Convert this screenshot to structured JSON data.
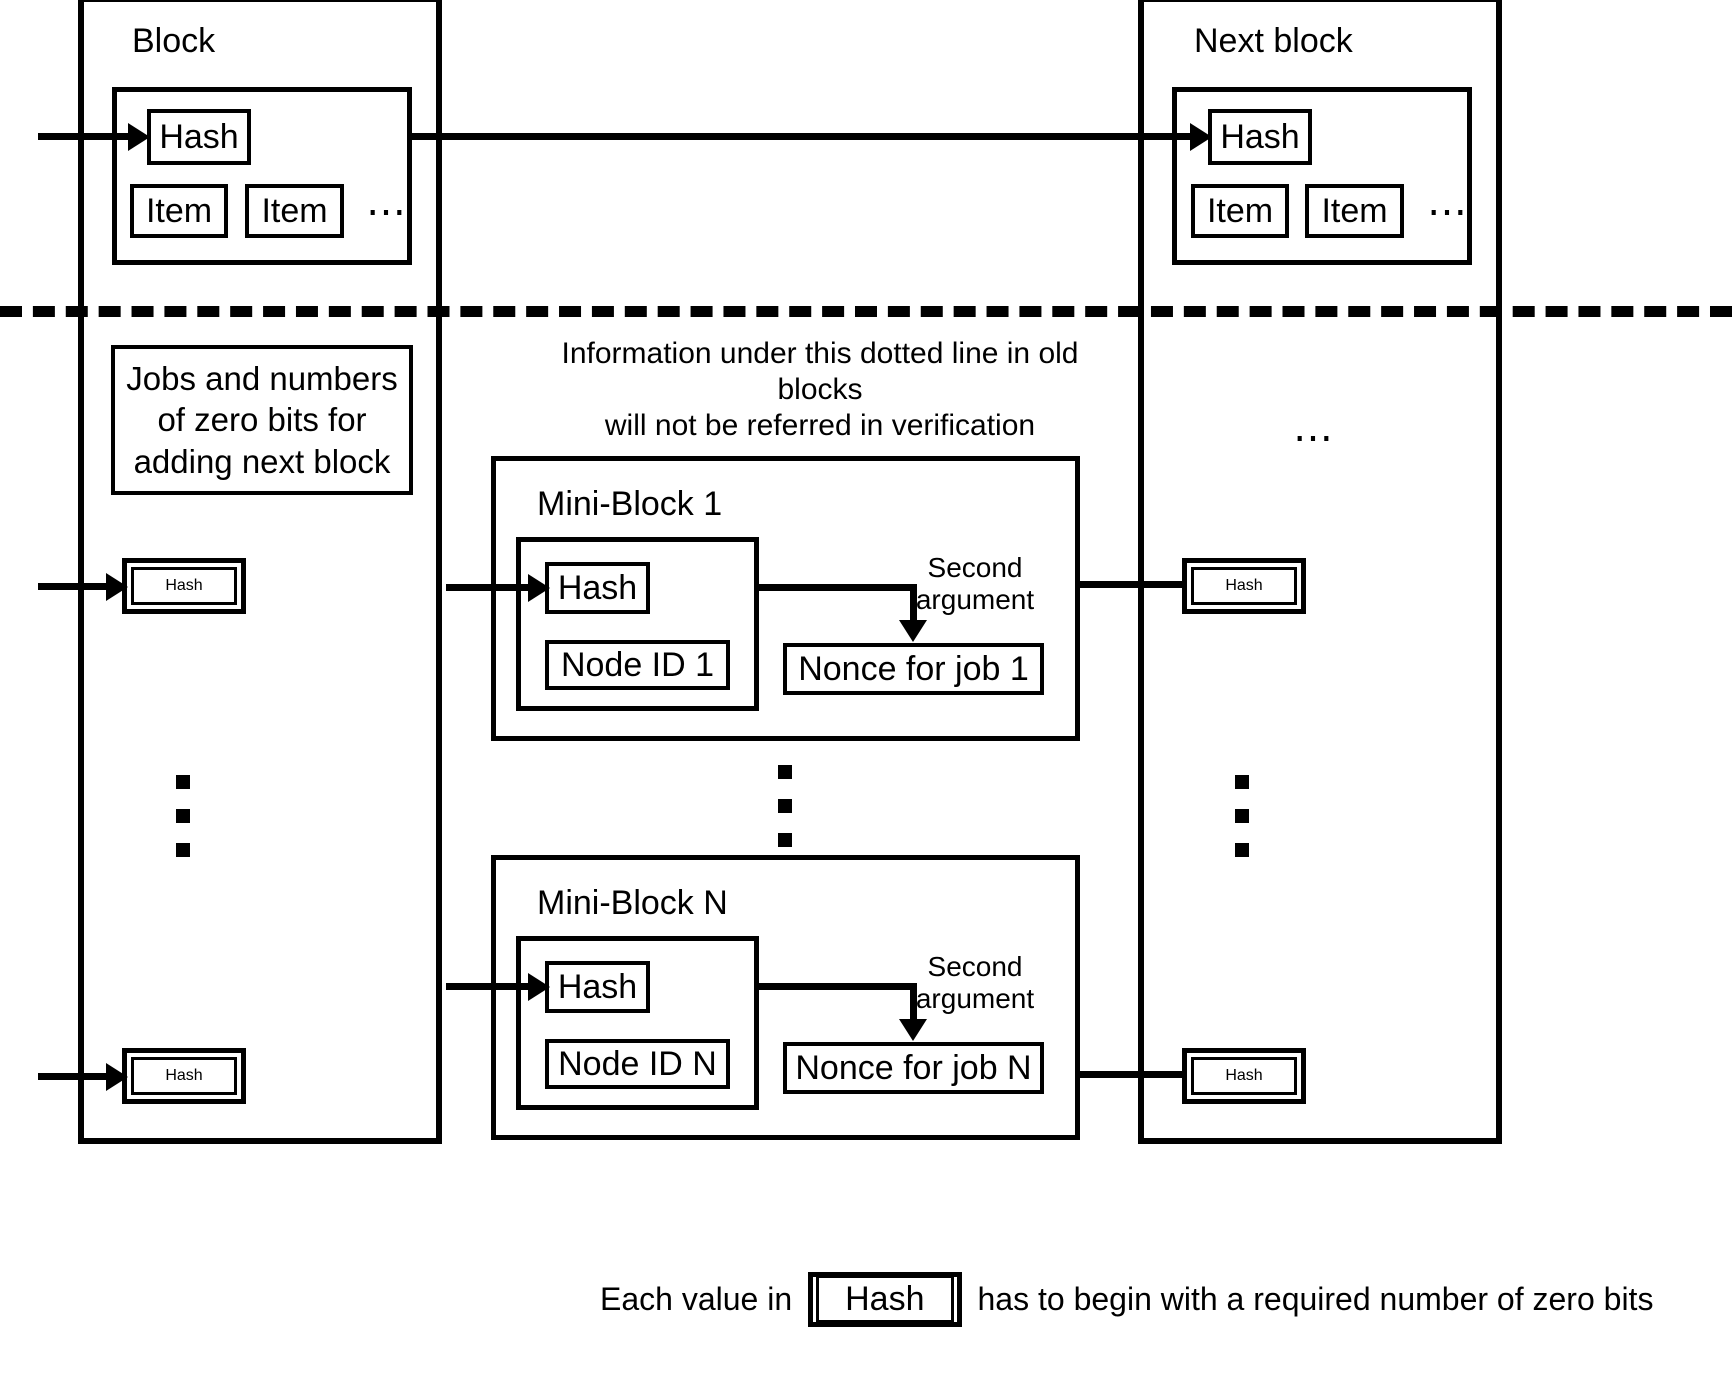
{
  "diagram": {
    "title_left_block": "Block",
    "title_right_block": "Next block",
    "separator_note": "Information under this dotted line in old blocks\nwill not be referred in verification",
    "jobs_box": "Jobs and numbers\nof zero bits for\nadding next block",
    "hash_label": "Hash",
    "item_label": "Item",
    "horizontal_ellipsis": "⋯",
    "mini_blocks": [
      {
        "title": "Mini-Block 1",
        "hash_label": "Hash",
        "node_id_label": "Node ID 1",
        "nonce_label": "Nonce for job 1",
        "arrow_note": "Second\nargument"
      },
      {
        "title": "Mini-Block N",
        "hash_label": "Hash",
        "node_id_label": "Node ID N",
        "nonce_label": "Nonce for job N",
        "arrow_note": "Second\nargument"
      }
    ],
    "left_column_hashes": [
      {
        "label": "Hash"
      },
      {
        "label": "Hash"
      }
    ],
    "right_column_hashes": [
      {
        "label": "Hash"
      },
      {
        "label": "Hash"
      }
    ],
    "legend": {
      "prefix": "Each value in",
      "hash_label": "Hash",
      "suffix": "has to begin with a required number of zero bits"
    },
    "colors": {
      "stroke": "#000000",
      "background": "#ffffff"
    }
  }
}
